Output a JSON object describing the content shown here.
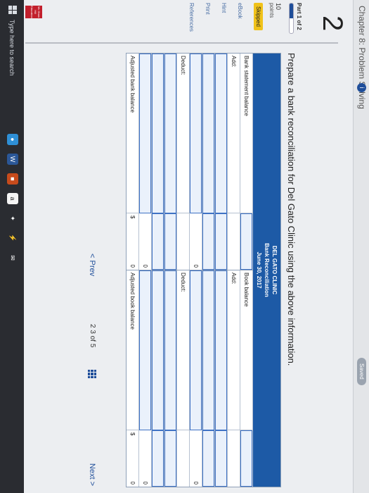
{
  "header": {
    "chapter_title": "Chapter 8: Problem Solving",
    "info_badge": "i",
    "saved": "Saved"
  },
  "question": {
    "number": "2",
    "part": "Part 1 of 2",
    "progress": 0.5,
    "points_value": "10",
    "points_label": "points",
    "status": "Skipped",
    "links": [
      "eBook",
      "Hint",
      "Print",
      "References"
    ],
    "prompt": "Prepare a bank reconciliation for Del Gato Clinic using the above information."
  },
  "reconciliation": {
    "company": "DEL GATO CLINIC",
    "title": "Bank Reconciliation",
    "date": "June 30, 2017",
    "left": {
      "balance_label": "Bank statement balance",
      "add_label": "Add:",
      "add_total": "0",
      "deduct_label": "Deduct:",
      "deduct_total": "0",
      "adjusted_label": "Adjusted bank balance",
      "currency": "$",
      "adjusted_total": "0"
    },
    "right": {
      "balance_label": "Book balance",
      "add_label": "Add:",
      "add_total": "0",
      "deduct_label": "Deduct:",
      "deduct_total": "0",
      "adjusted_label": "Adjusted book balance",
      "currency": "$",
      "adjusted_total": "0"
    }
  },
  "pagination": {
    "prev": "< Prev",
    "current": "2",
    "current2": "3",
    "of": "of",
    "total": "5",
    "next": "Next >"
  },
  "logo_text": "Mc Graw Hill Education",
  "taskbar": {
    "search_placeholder": "Type here to search",
    "icons": [
      "chrome-icon",
      "word-icon",
      "store-icon",
      "amazon-icon",
      "dropbox-icon",
      "app-icon",
      "mail-icon"
    ]
  },
  "colors": {
    "header_blue": "#1d5aa6",
    "skipped_yellow": "#f0c21a",
    "logo_red": "#c21f2c"
  }
}
